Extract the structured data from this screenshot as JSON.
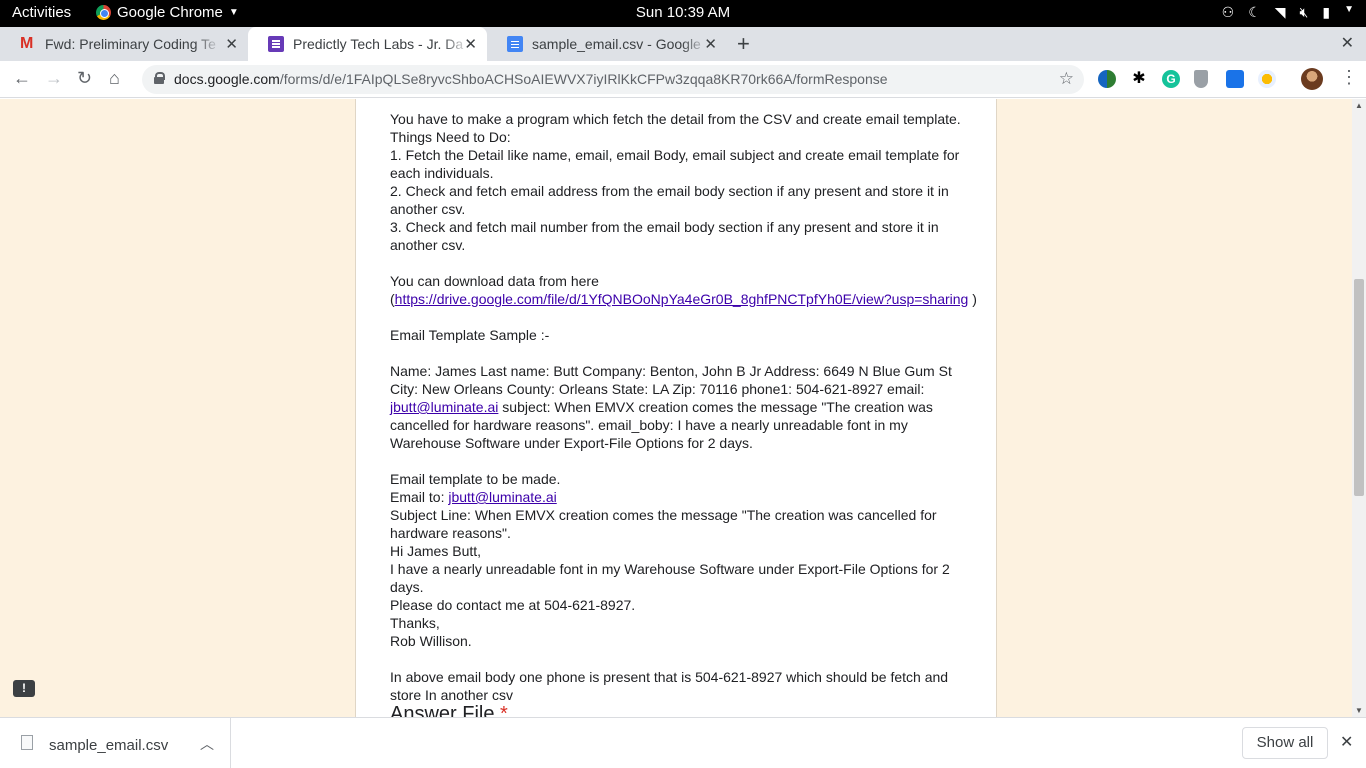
{
  "system_bar": {
    "activities": "Activities",
    "app_name": "Google Chrome",
    "clock": "Sun 10:39 AM"
  },
  "tabs": [
    {
      "title": "Fwd: Preliminary Coding Te",
      "icon": "gmail-icon",
      "active": false
    },
    {
      "title": "Predictly Tech Labs - Jr. Da",
      "icon": "google-forms-icon",
      "active": true
    },
    {
      "title": "sample_email.csv - Google",
      "icon": "google-docs-icon",
      "active": false
    }
  ],
  "address_bar": {
    "host": "docs.google.com",
    "path": "/forms/d/e/1FAIpQLSe8ryvcShboACHSoAIEWVX7iyIRlKkCFPw3zqqa8KR70rk66A/formResponse"
  },
  "form": {
    "lines": [
      "You have to make a program which fetch the detail from the CSV and create email template.",
      "Things Need to Do:",
      "1. Fetch the Detail like name, email, email Body, email subject and create email template for each individuals.",
      "2. Check and fetch email address from the email body section if any present and store it in another csv.",
      "3. Check and fetch mail number from the email body section if any present and store it in another csv."
    ],
    "download_text": "You can download data from here",
    "download_open": "(",
    "download_link": "https://drive.google.com/file/d/1YfQNBOoNpYa4eGr0B_8ghfPNCTpfYh0E/view?usp=sharing",
    "download_close": " )",
    "sample_heading": "Email Template Sample :-",
    "sample_pre": "Name: James Last name: Butt Company: Benton, John B Jr Address: 6649 N Blue Gum St City: New Orleans County: Orleans State: LA Zip: 70116 phone1: 504-621-8927 email: ",
    "sample_email": "jbutt@luminate.ai",
    "sample_post": " subject: When EMVX creation comes the message \"The creation was cancelled for hardware reasons\". email_boby: I have a nearly unreadable font in my Warehouse Software under Export-File Options for 2 days.",
    "template_heading": "Email template to be made.",
    "email_to_label": "Email to: ",
    "email_to": "jbutt@luminate.ai",
    "subject_line": "Subject Line: When EMVX creation comes the message \"The creation was cancelled for hardware reasons\".",
    "greeting": "Hi James Butt,",
    "body": "I have a nearly unreadable font in my Warehouse Software under Export-File Options for 2 days.",
    "contact": "Please do contact me at 504-621-8927.",
    "thanks": "Thanks,",
    "signature": "Rob Willison.",
    "note": "In above email body one phone is present that is 504-621-8927 which should be fetch and store In another csv",
    "answer_label": "Answer File",
    "required_mark": "*"
  },
  "download_shelf": {
    "file_name": "sample_email.csv",
    "show_all": "Show all"
  }
}
